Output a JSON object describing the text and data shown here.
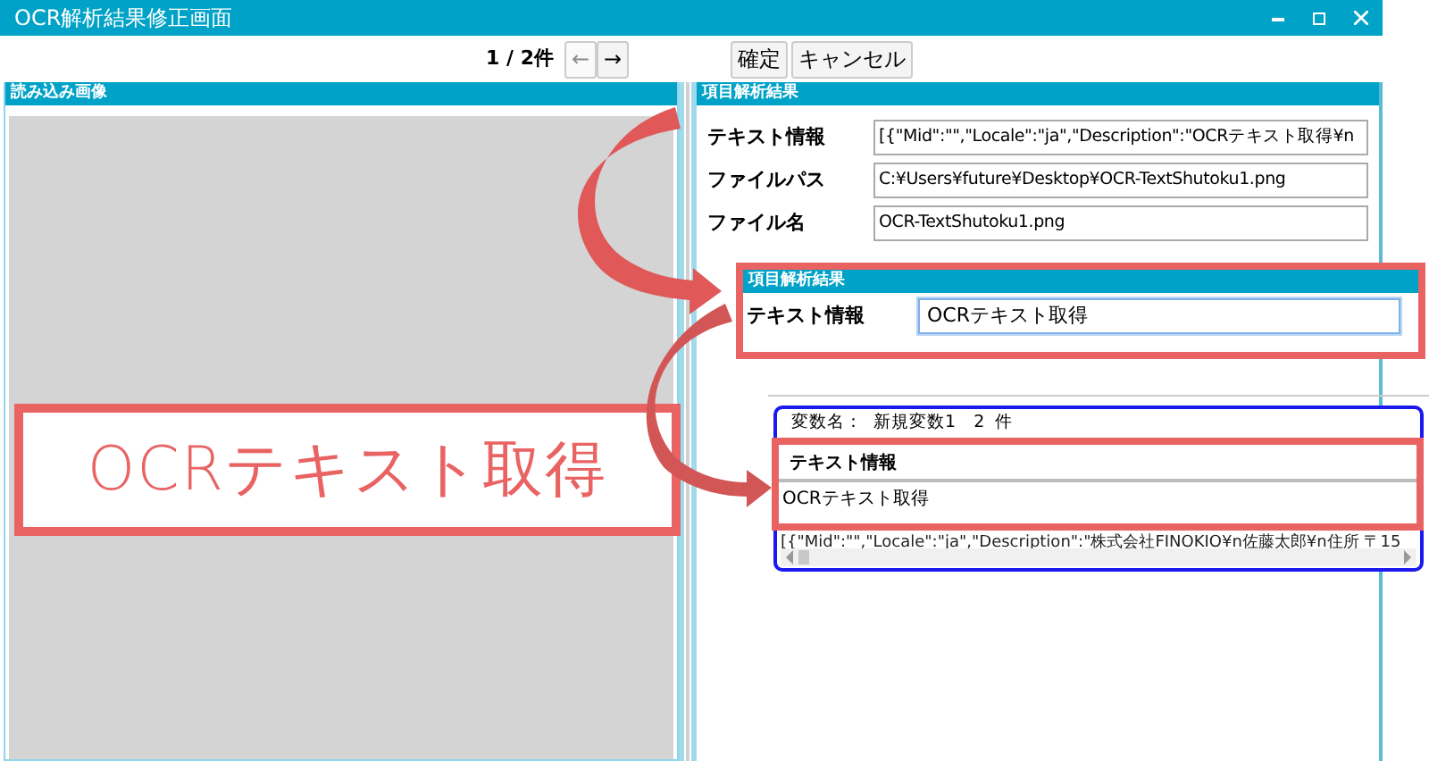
{
  "window": {
    "title": "OCR解析結果修正画面"
  },
  "pager": {
    "text": "1 / 2件",
    "prev": {
      "label": "←",
      "disabled": true
    },
    "next": {
      "label": "→",
      "disabled": false
    }
  },
  "buttons": [
    "確定",
    "キャンセル"
  ],
  "left_panel": {
    "title": "読み込み画像"
  },
  "right_panel": {
    "title": "項目解析結果",
    "fields": [
      {
        "label": "テキスト情報",
        "value": "[{\"Mid\":\"\",\"Locale\":\"ja\",\"Description\":\"OCRテキスト取得¥n"
      },
      {
        "label": "ファイルパス",
        "value": "C:¥Users¥future¥Desktop¥OCR-TextShutoku1.png"
      },
      {
        "label": "ファイル名",
        "value": "OCR-TextShutoku1.png"
      }
    ]
  },
  "zoom_callout": {
    "title": "項目解析結果",
    "label": "テキスト情報",
    "value": "OCRテキスト取得",
    "focused": true
  },
  "variable_panel": {
    "caption": "変数名：",
    "variable": "新規変数1",
    "count": "2",
    "unit": "件",
    "column": "テキスト情報",
    "rows": [
      "OCRテキスト取得",
      "[{\"Mid\":\"\",\"Locale\":\"ja\",\"Description\":\"株式会社FINOKIO¥n佐藤太郎¥n住所 〒15"
    ]
  },
  "highlight_text": "OCRテキスト取得"
}
